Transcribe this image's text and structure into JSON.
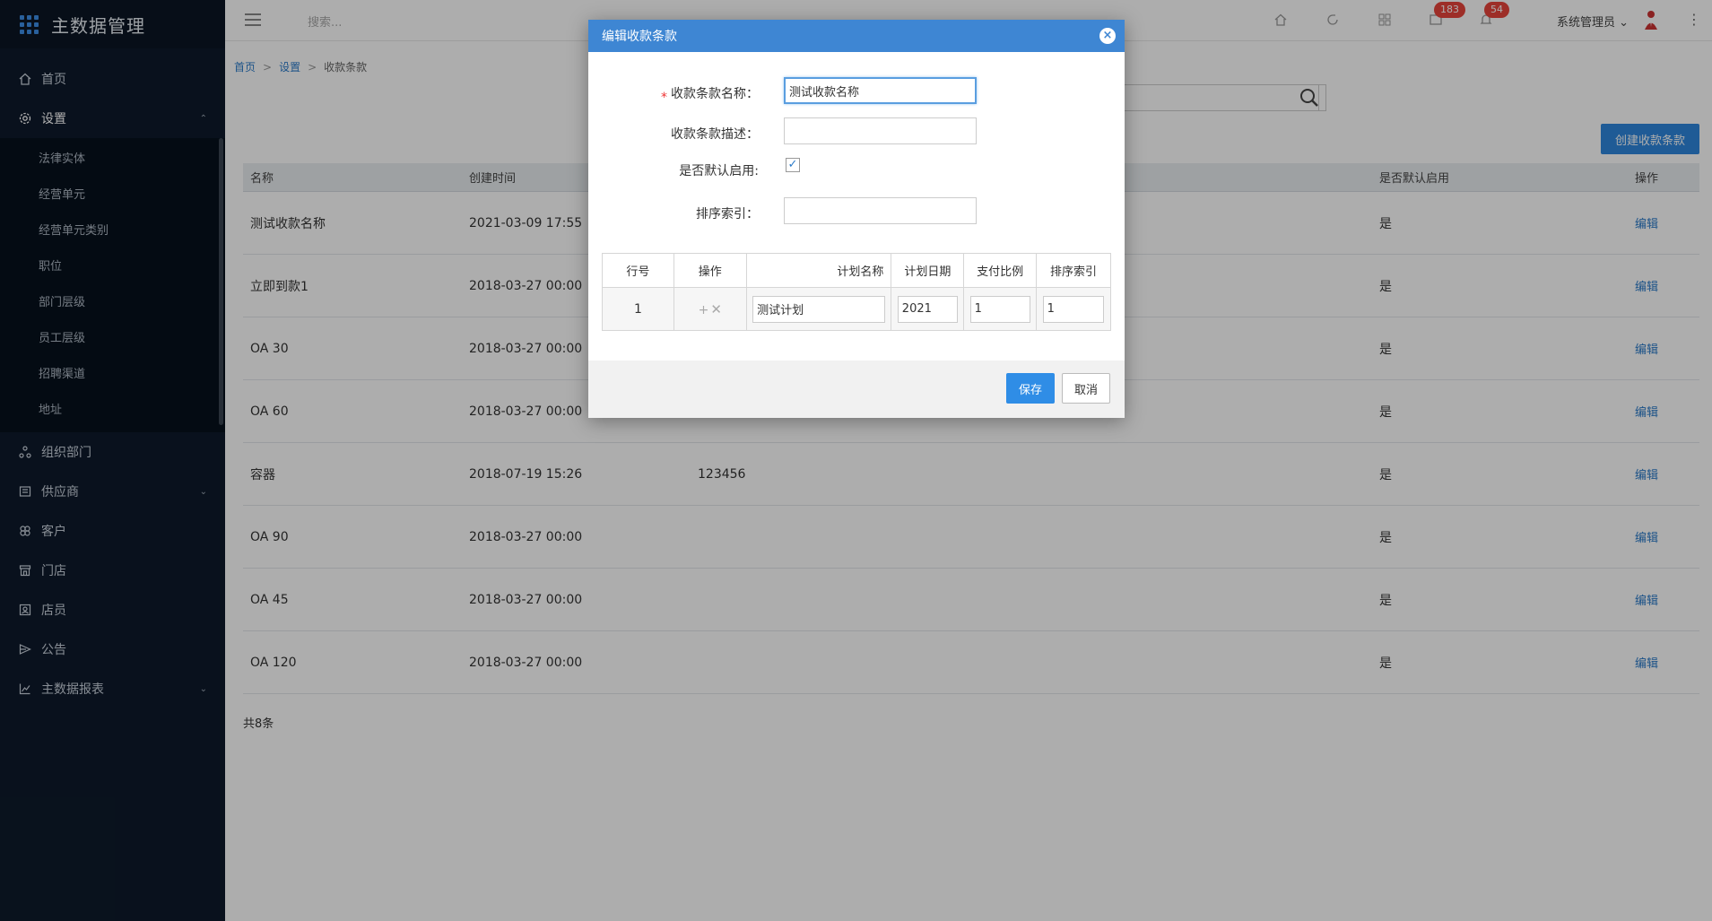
{
  "app": {
    "title": "主数据管理"
  },
  "sidebar": {
    "items": [
      {
        "label": "首页",
        "icon": "home-icon"
      },
      {
        "label": "设置",
        "icon": "gear-icon"
      },
      {
        "label": "组织部门",
        "icon": "org-icon"
      },
      {
        "label": "供应商",
        "icon": "supplier-icon"
      },
      {
        "label": "客户",
        "icon": "customer-icon"
      },
      {
        "label": "门店",
        "icon": "store-icon"
      },
      {
        "label": "店员",
        "icon": "clerk-icon"
      },
      {
        "label": "公告",
        "icon": "announcement-icon"
      },
      {
        "label": "主数据报表",
        "icon": "chart-icon"
      }
    ],
    "settings_sub": [
      "法律实体",
      "经营单元",
      "经营单元类别",
      "职位",
      "部门层级",
      "员工层级",
      "招聘渠道",
      "地址"
    ]
  },
  "topbar": {
    "search_placeholder": "搜索...",
    "badge_messages": "183",
    "badge_notifications": "54",
    "user": "系统管理员"
  },
  "breadcrumb": {
    "home": "首页",
    "settings": "设置",
    "current": "收款条款"
  },
  "list": {
    "create_button": "创建收款条款",
    "headers": {
      "name": "名称",
      "time": "创建时间",
      "default": "是否默认启用",
      "op": "操作"
    },
    "rows": [
      {
        "name": "测试收款名称",
        "time": "2021-03-09 17:55",
        "desc": "",
        "default": "是",
        "op": "编辑"
      },
      {
        "name": "立即到款1",
        "time": "2018-03-27 00:00",
        "desc": "",
        "default": "是",
        "op": "编辑"
      },
      {
        "name": "OA 30",
        "time": "2018-03-27 00:00",
        "desc": "",
        "default": "是",
        "op": "编辑"
      },
      {
        "name": "OA 60",
        "time": "2018-03-27 00:00",
        "desc": "",
        "default": "是",
        "op": "编辑"
      },
      {
        "name": "容器",
        "time": "2018-07-19 15:26",
        "desc": "123456",
        "default": "是",
        "op": "编辑"
      },
      {
        "name": "OA 90",
        "time": "2018-03-27 00:00",
        "desc": "",
        "default": "是",
        "op": "编辑"
      },
      {
        "name": "OA 45",
        "time": "2018-03-27 00:00",
        "desc": "",
        "default": "是",
        "op": "编辑"
      },
      {
        "name": "OA 120",
        "time": "2018-03-27 00:00",
        "desc": "",
        "default": "是",
        "op": "编辑"
      }
    ],
    "total": "共8条"
  },
  "modal": {
    "title": "编辑收款条款",
    "required_mark": "*",
    "fields": {
      "name_label": "收款条款名称：",
      "name_value": "测试收款名称",
      "desc_label": "收款条款描述：",
      "desc_value": "",
      "default_label": "是否默认启用:",
      "default_checked": "✓",
      "sort_label": "排序索引：",
      "sort_value": ""
    },
    "plan_table": {
      "headers": [
        "行号",
        "操作",
        "计划名称",
        "计划日期",
        "支付比例",
        "排序索引"
      ],
      "row": {
        "line": "1",
        "plan_name": "测试计划",
        "plan_date": "2021",
        "ratio": "1",
        "sort": "1"
      }
    },
    "save": "保存",
    "cancel": "取消"
  }
}
